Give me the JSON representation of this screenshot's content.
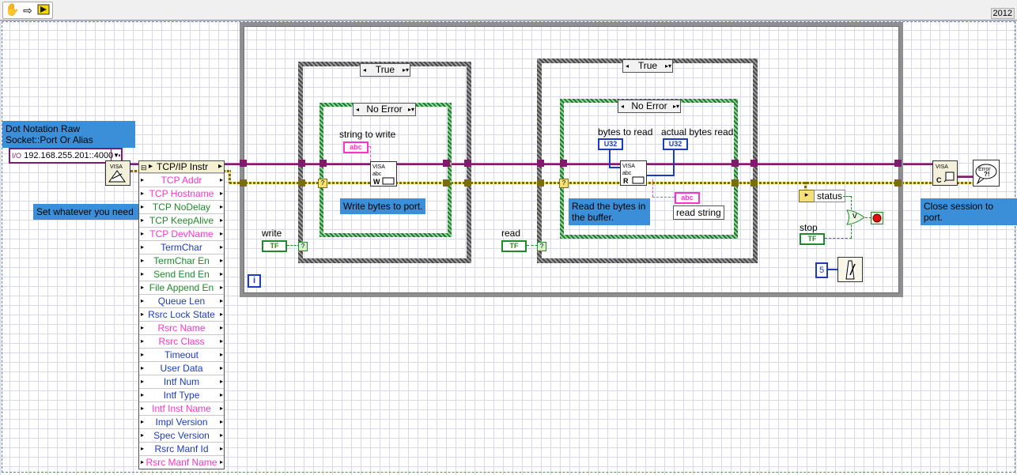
{
  "toolbar": {
    "version": "2012",
    "icons": [
      "hand-icon",
      "arrow-icon",
      "labview-run-icon"
    ]
  },
  "resource": {
    "label": "Dot Notation Raw Socket::Port Or Alias",
    "value": "192.168.255.201::4000"
  },
  "comments": {
    "set_whatever": "Set whatever you need",
    "write_bytes": "Write bytes to port.",
    "read_bytes": "Read the bytes in the buffer.",
    "close_session": "Close session to port."
  },
  "property_node": {
    "class": "TCP/IP Instr",
    "rows": [
      {
        "label": "TCP Addr",
        "color": "#ff33cc"
      },
      {
        "label": "TCP Hostname",
        "color": "#ff33cc"
      },
      {
        "label": "TCP NoDelay",
        "color": "#1f8a2b"
      },
      {
        "label": "TCP KeepAlive",
        "color": "#1f8a2b"
      },
      {
        "label": "TCP DevName",
        "color": "#ff33cc"
      },
      {
        "label": "TermChar",
        "color": "#1d3bbd"
      },
      {
        "label": "TermChar En",
        "color": "#1f8a2b"
      },
      {
        "label": "Send End En",
        "color": "#1f8a2b"
      },
      {
        "label": "File Append En",
        "color": "#1f8a2b"
      },
      {
        "label": "Queue Len",
        "color": "#1d3bbd"
      },
      {
        "label": "Rsrc Lock State",
        "color": "#1d3bbd"
      },
      {
        "label": "Rsrc Name",
        "color": "#ff33cc"
      },
      {
        "label": "Rsrc Class",
        "color": "#ff33cc"
      },
      {
        "label": "Timeout",
        "color": "#1d3bbd"
      },
      {
        "label": "User Data",
        "color": "#1d3bbd"
      },
      {
        "label": "Intf Num",
        "color": "#1d3bbd"
      },
      {
        "label": "Intf Type",
        "color": "#1d3bbd"
      },
      {
        "label": "Intf Inst Name",
        "color": "#ff33cc"
      },
      {
        "label": "Impl Version",
        "color": "#1d3bbd"
      },
      {
        "label": "Spec Version",
        "color": "#1d3bbd"
      },
      {
        "label": "Rsrc Manf Id",
        "color": "#1d3bbd"
      },
      {
        "label": "Rsrc Manf Name",
        "color": "#ff33cc"
      }
    ]
  },
  "write_case": {
    "selector": "True",
    "inner_selector": "No Error",
    "control_label": "string to write",
    "terminal": "abc",
    "vi_letter": "W"
  },
  "read_case": {
    "selector": "True",
    "inner_selector": "No Error",
    "bytes_to_read": "bytes to read",
    "actual_bytes": "actual bytes read",
    "read_string": "read string",
    "terminal_u32": "U32",
    "terminal_str": "abc",
    "vi_letter": "R"
  },
  "controls": {
    "write_label": "write",
    "read_label": "read",
    "status_label": "status",
    "stop_label": "stop",
    "bool_terminal": "TF",
    "wait_value": "5",
    "iteration": "i",
    "or_symbol": "v",
    "visa_text": "VISA",
    "close_letter": "C",
    "error_text": "Error"
  }
}
